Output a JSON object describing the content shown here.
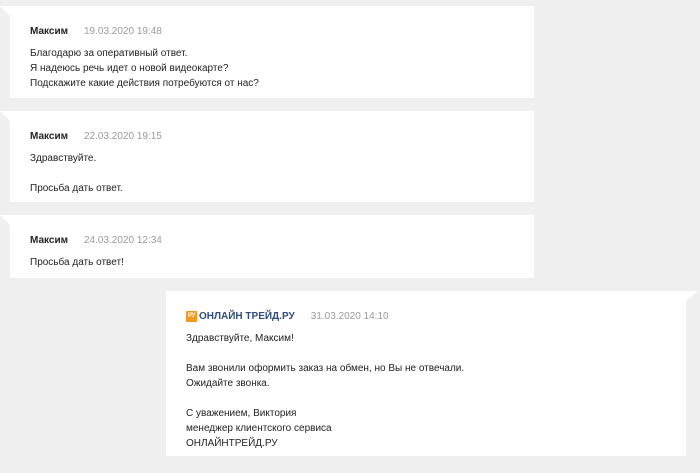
{
  "messages": [
    {
      "author": "Максим",
      "time": "19.03.2020 19:48",
      "lines": [
        "Благодарю за оперативный ответ.",
        "Я надеюсь речь идет о новой видеокарте?",
        "Подскажите какие действия потребуются от нас?"
      ]
    },
    {
      "author": "Максим",
      "time": "22.03.2020 19:15",
      "lines": [
        "Здравствуйте.",
        "",
        "Просьба дать ответ."
      ]
    },
    {
      "author": "Максим",
      "time": "24.03.2020 12:34",
      "lines": [
        "Просьба дать ответ!"
      ]
    },
    {
      "author_logo": "РУ",
      "author": "ОНЛАЙН ТРЕЙД.РУ",
      "time": "31.03.2020 14:10",
      "lines": [
        "Здравствуйте, Максим!",
        "",
        "Вам звонили оформить заказ на обмен, но Вы не отвечали.",
        "Ожидайте звонка.",
        "",
        "С уважением, Виктория",
        "менеджер клиентского сервиса",
        "ОНЛАЙНТРЕЙД.РУ"
      ]
    }
  ],
  "colors": {
    "background": "#efefef",
    "bubble": "#ffffff",
    "brand_name": "#2f4d7a",
    "brand_logo": "#f29a1f",
    "timestamp": "#9a9a9a"
  },
  "icons": {
    "brand_logo": "onlinetrade-logo-icon"
  }
}
